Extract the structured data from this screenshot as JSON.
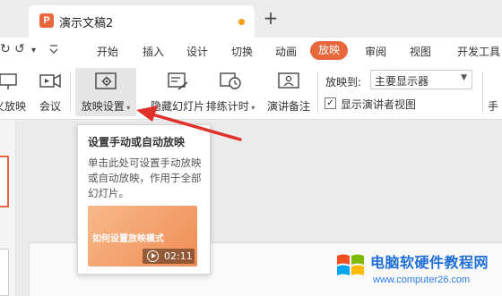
{
  "tab": {
    "title": "演示文稿2",
    "app_icon_letter": "P"
  },
  "quick_access": {
    "redo_symbol": "↺",
    "undo_symbol": "↻",
    "dropdown_symbol": "▾"
  },
  "menu_tabs": [
    "开始",
    "插入",
    "设计",
    "切换",
    "动画",
    "放映",
    "审阅",
    "视图",
    "开发工具"
  ],
  "active_tab": "放映",
  "ribbon": {
    "buttons": [
      {
        "label": "义放映",
        "icon": "custom-show-icon"
      },
      {
        "label": "会议",
        "icon": "meeting-icon"
      },
      {
        "label": "放映设置",
        "icon": "slideshow-settings-icon",
        "has_dropdown": true
      },
      {
        "label": "隐藏幻灯片",
        "icon": "hide-slide-icon"
      },
      {
        "label": "排练计时",
        "icon": "rehearse-timing-icon",
        "has_dropdown": true
      },
      {
        "label": "演讲备注",
        "icon": "speaker-notes-icon"
      }
    ],
    "play_to_label": "放映到:",
    "monitor_select_value": "主要显示器",
    "presenter_view_label": "显示演讲者视图",
    "presenter_view_checked": true,
    "right_cut_label": "手"
  },
  "tooltip": {
    "title": "设置手动或自动放映",
    "description": "单击此处可设置手动放映或自动放映，作用于全部幻灯片。",
    "video_title": "如何设置放映模式",
    "video_duration": "02:11"
  },
  "watermark": {
    "text": "电脑软硬件教程网",
    "url": "www.computer26.com"
  },
  "colors": {
    "accent": "#e8663b",
    "arrow": "#e0302a",
    "watermark_blue": "#1f6fd6"
  }
}
